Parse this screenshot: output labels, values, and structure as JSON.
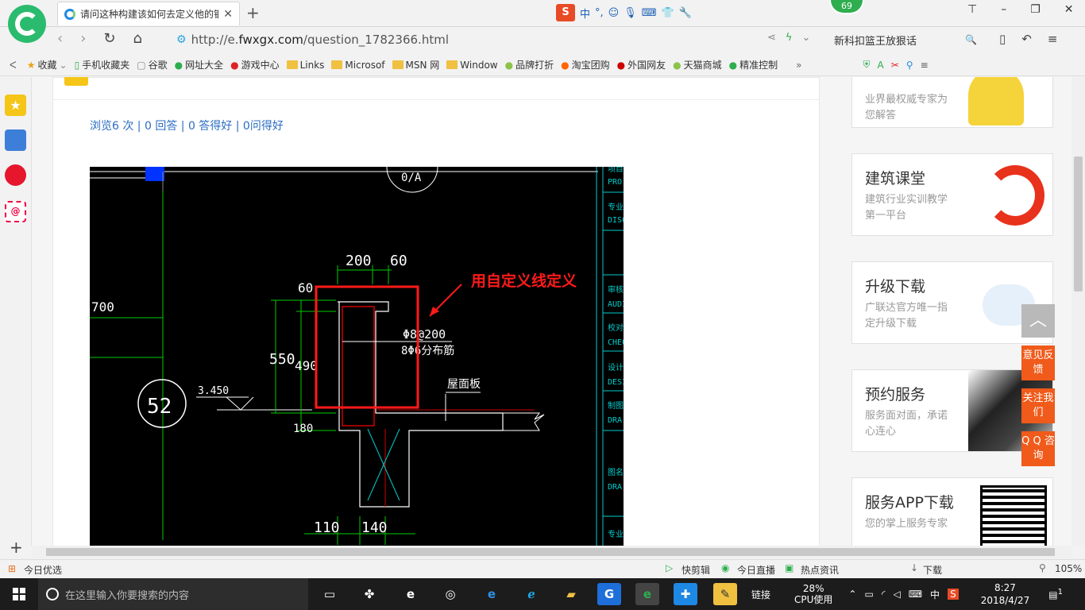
{
  "tab": {
    "title": "请问这种构建该如何去定义他的钢",
    "close": "✕",
    "new": "+"
  },
  "tray": {
    "sogou": "S",
    "lang": "中",
    "punct": "°,"
  },
  "badge": "69",
  "window": {
    "min": "–",
    "max": "❐",
    "close": "✕",
    "pin": "⊤"
  },
  "address": {
    "url_prefix": "http://e.",
    "url_domain": "fwxgx.com",
    "url_path": "/question_1782366.html"
  },
  "search": {
    "text": "新科扣篮王放狠话",
    "icon": "🔍"
  },
  "bookmarks": [
    {
      "label": "收藏",
      "icon": "★"
    },
    {
      "label": "手机收藏夹",
      "icon": "▯"
    },
    {
      "label": "谷歌",
      "icon": "▢"
    },
    {
      "label": "网址大全",
      "icon": "●"
    },
    {
      "label": "游戏中心",
      "icon": "●"
    },
    {
      "label": "Links",
      "icon": "fold"
    },
    {
      "label": "Microsof",
      "icon": "fold"
    },
    {
      "label": "MSN 网",
      "icon": "fold"
    },
    {
      "label": "Window",
      "icon": "fold"
    },
    {
      "label": "品牌打折",
      "icon": "●"
    },
    {
      "label": "淘宝团购",
      "icon": "●"
    },
    {
      "label": "外国网友",
      "icon": "●"
    },
    {
      "label": "天猫商城",
      "icon": "●"
    },
    {
      "label": "精准控制",
      "icon": "●"
    }
  ],
  "question": {
    "stats": "浏览6 次 | 0 回答 | 0 答得好 | 0问得好"
  },
  "cad": {
    "annotation": "用自定义线定义",
    "dims": {
      "d200": "200",
      "d60": "60",
      "d60v": "60",
      "d550": "550",
      "d490": "490",
      "d180": "180",
      "d110": "110",
      "d140": "140",
      "d700": "700"
    },
    "axis": "52",
    "elev": "3.450",
    "rebar1": "Φ8@200",
    "rebar2": "8Φ6分布筋",
    "slab": "屋面板",
    "axis_top": "0/A",
    "panel": [
      "项目",
      "PRO",
      "专业",
      "DISC",
      "审核",
      "AUDI",
      "校对",
      "CHEC",
      "设计",
      "DESI",
      "制图",
      "DRA",
      "图名",
      "DRA",
      "专业"
    ]
  },
  "cards": [
    {
      "title": "",
      "desc": "业界最权威专家为您解答"
    },
    {
      "title": "建筑课堂",
      "desc": "建筑行业实训教学第一平台"
    },
    {
      "title": "升级下载",
      "desc": "广联达官方唯一指定升级下载"
    },
    {
      "title": "预约服务",
      "desc": "服务面对面，承诺心连心"
    },
    {
      "title": "服务APP下载",
      "desc": "您的掌上服务专家"
    }
  ],
  "float": {
    "feedback": "意见反馈",
    "follow": "关注我们",
    "qq": "Q Q 咨询",
    "top": "︿"
  },
  "status": {
    "left": "今日优选",
    "items": [
      "快剪辑",
      "今日直播",
      "热点资讯"
    ],
    "download": "下载",
    "zoom": "105%"
  },
  "taskbar": {
    "search": "在这里输入你要搜索的内容",
    "link": "链接",
    "cpu_pct": "28%",
    "cpu_label": "CPU使用",
    "ime": "中",
    "time": "8:27",
    "date": "2018/4/27",
    "notif": "1"
  }
}
